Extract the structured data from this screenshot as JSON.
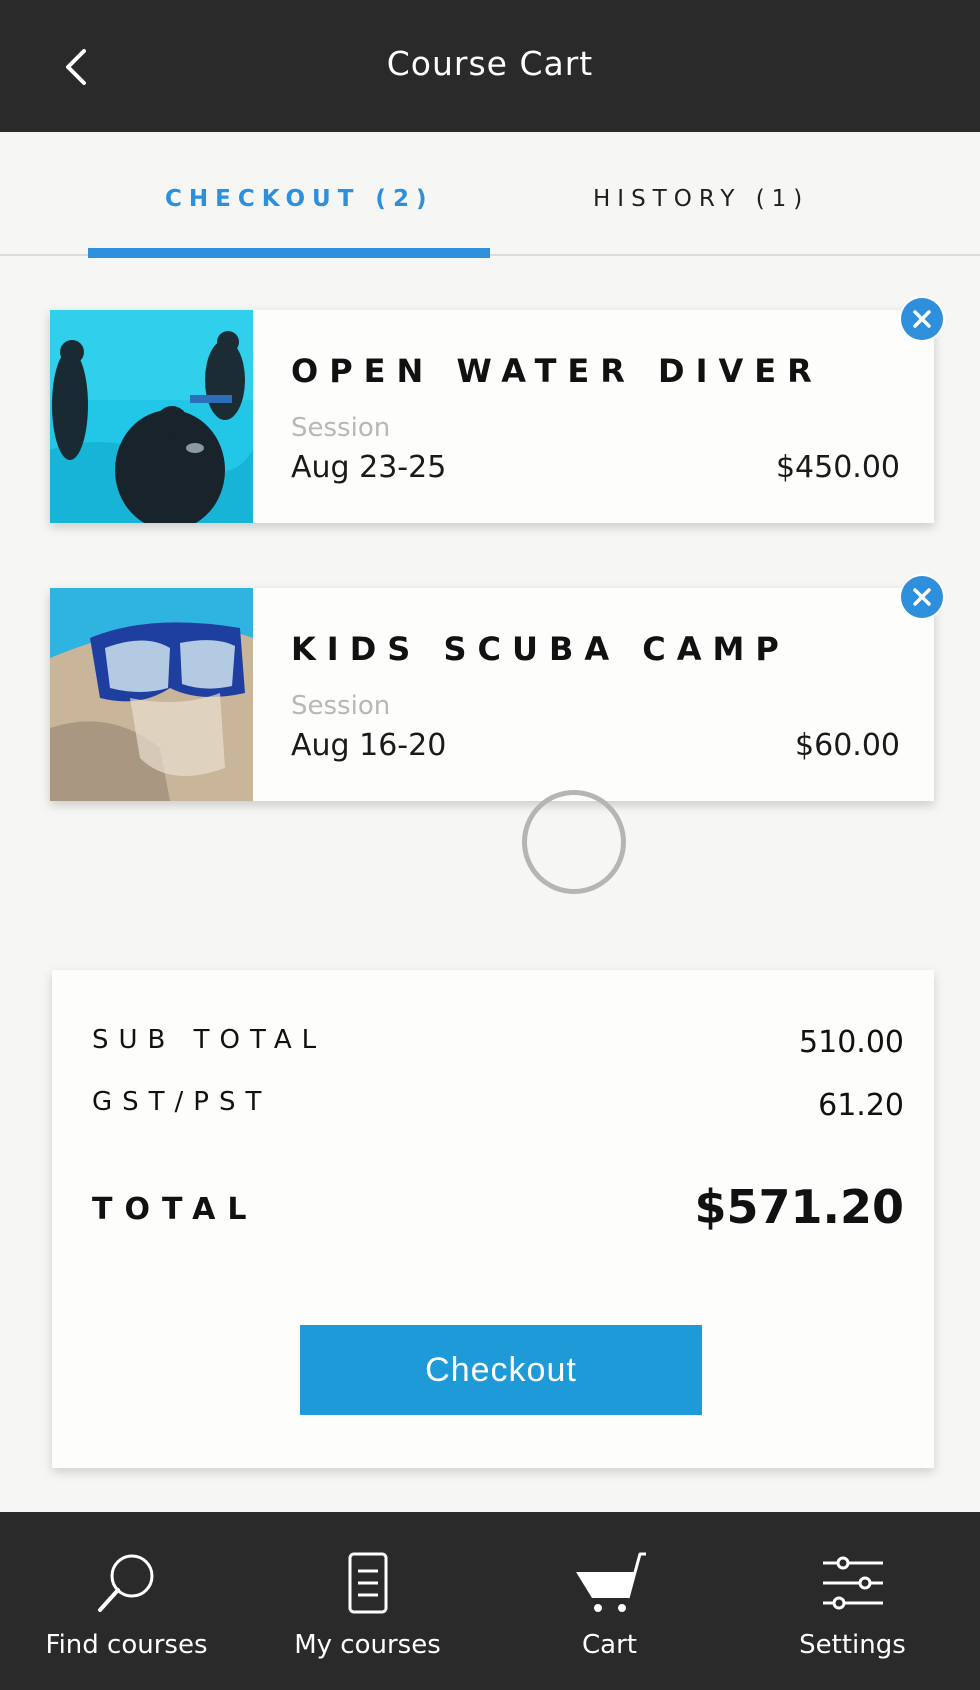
{
  "header": {
    "title": "Course Cart",
    "back_icon": "chevron-left-icon"
  },
  "tabs": [
    {
      "label": "CHECKOUT (2)",
      "active": true
    },
    {
      "label": "HISTORY (1)",
      "active": false
    }
  ],
  "accent_color": "#2e8fdc",
  "cart_items": [
    {
      "name": "OPEN WATER DIVER",
      "session_label": "Session",
      "dates": "Aug 23-25",
      "price": "$450.00",
      "remove_icon": "close-icon"
    },
    {
      "name": "KIDS SCUBA CAMP",
      "session_label": "Session",
      "dates": "Aug 16-20",
      "price": "$60.00",
      "remove_icon": "close-icon"
    }
  ],
  "summary": {
    "subtotal_label": "SUB TOTAL",
    "subtotal_value": "510.00",
    "tax_label": "GST/PST",
    "tax_value": "61.20",
    "total_label": "TOTAL",
    "total_value": "$571.20",
    "checkout_label": "Checkout"
  },
  "bottom_nav": [
    {
      "label": "Find courses",
      "icon": "search-icon"
    },
    {
      "label": "My courses",
      "icon": "document-icon"
    },
    {
      "label": "Cart",
      "icon": "cart-icon"
    },
    {
      "label": "Settings",
      "icon": "sliders-icon"
    }
  ]
}
